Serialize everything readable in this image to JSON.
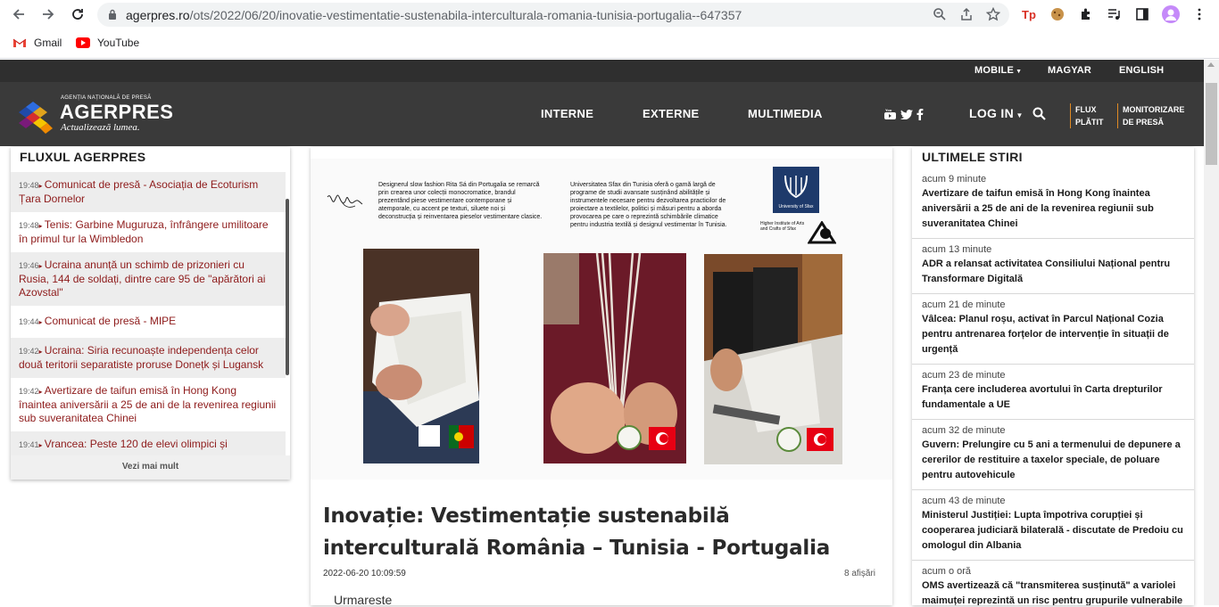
{
  "browser": {
    "url_host": "agerpres.ro",
    "url_path": "/ots/2022/06/20/inovatie-vestimentatie-sustenabila-interculturala-romania-tunisia-portugalia--647357",
    "bookmarks": [
      "Gmail",
      "YouTube"
    ],
    "colors": {
      "omnibox": "#f1f3f4"
    }
  },
  "site": {
    "topbar": {
      "mobile": "MOBILE",
      "magyar": "MAGYAR",
      "english": "ENGLISH"
    },
    "logo": {
      "agency": "AGENȚIA NAȚIONALĂ DE PRESĂ",
      "name": "AGERPRES",
      "tagline": "Actualizează lumea."
    },
    "nav": {
      "interne": "INTERNE",
      "externe": "EXTERNE",
      "multimedia": "MULTIMEDIA",
      "login": "LOG IN",
      "flux_1": "FLUX",
      "flux_2": "PLĂTIT",
      "monitor_1": "MONITORIZARE",
      "monitor_2": "DE PRESĂ"
    },
    "colors": {
      "header": "#3a3a3a",
      "topbar": "#2f2f2f",
      "accent": "#e08a24",
      "link": "#8e1b1b"
    }
  },
  "left": {
    "title": "FLUXUL AGERPRES",
    "items": [
      {
        "time": "19:48",
        "text": "Comunicat de presă - Asociația de Ecoturism Țara Dornelor"
      },
      {
        "time": "19:48",
        "text": "Tenis: Garbine Muguruza, înfrângere umilitoare în primul tur la Wimbledon"
      },
      {
        "time": "19:46",
        "text": "Ucraina anunță un schimb de prizonieri cu Rusia, 144 de soldați, dintre care 95 de \"apărători ai Azovstal\""
      },
      {
        "time": "19:44",
        "text": "Comunicat de presă - MIPE"
      },
      {
        "time": "19:42",
        "text": "Ucraina: Siria recunoaște independența celor două teritorii separatiste proruse Donețk și Lugansk"
      },
      {
        "time": "19:42",
        "text": "Avertizare de taifun emisă în Hong Kong înaintea aniversării a 25 de ani de la revenirea regiunii sub suveranitatea Chinei"
      },
      {
        "time": "19:41",
        "text": "Vrancea: Peste 120 de elevi olimpici și"
      }
    ],
    "more": "Vezi mai mult"
  },
  "article": {
    "image_text_left": "Designerul slow fashion Rita Sá din Portugalia se remarcă prin crearea unor colecții monocromatice, brandul prezentând piese vestimentare contemporane și atemporale, cu accent pe texturi, siluete noi și deconstrucția și reinventarea pieselor vestimentare clasice.",
    "image_text_right": "Universitatea Sfax din Tunisia oferă o gamă largă de programe de studii avansate susținând abilitățile și instrumentele necesare pentru dezvoltarea practicilor de proiectare a textilelor, politici și măsuri pentru a aborda provocarea pe care o reprezintă schimbările climatice pentru industria textilă și designul vestimentar în Tunisia.",
    "univ_label": "University of Sfax",
    "institute_label": "Higher Institute of Arts and Crafts of Sfax",
    "title": "Inovație: Vestimentație sustenabilă interculturală România – Tunisia - Portugalia",
    "date": "2022-06-20 10:09:59",
    "views": "8 afișări",
    "follow": "Urmareste"
  },
  "right": {
    "title": "ULTIMELE STIRI",
    "items": [
      {
        "ago": "acum 9 minute",
        "text": "Avertizare de taifun emisă în Hong Kong înaintea aniversării a 25 de ani de la revenirea regiunii sub suveranitatea Chinei"
      },
      {
        "ago": "acum 13 minute",
        "text": "ADR a relansat activitatea Consiliului Național pentru Transformare Digitală"
      },
      {
        "ago": "acum 21 de minute",
        "text": "Vâlcea: Planul roșu, activat în Parcul Național Cozia pentru antrenarea forțelor de intervenție în situații de urgență"
      },
      {
        "ago": "acum 23 de minute",
        "text": "Franța cere includerea avortului în Carta drepturilor fundamentale a UE"
      },
      {
        "ago": "acum 32 de minute",
        "text": "Guvern: Prelungire cu 5 ani a termenului de depunere a cererilor de restituire a taxelor speciale, de poluare pentru autovehicule"
      },
      {
        "ago": "acum 43 de minute",
        "text": "Ministerul Justiției: Lupta împotriva corupției și cooperarea judiciară bilaterală - discutate de Predoiu cu omologul din Albania"
      },
      {
        "ago": "acum o oră",
        "text": "OMS avertizează că \"transmiterea susținută\" a variolei maimuței reprezintă un risc pentru grupurile vulnerabile"
      }
    ]
  }
}
